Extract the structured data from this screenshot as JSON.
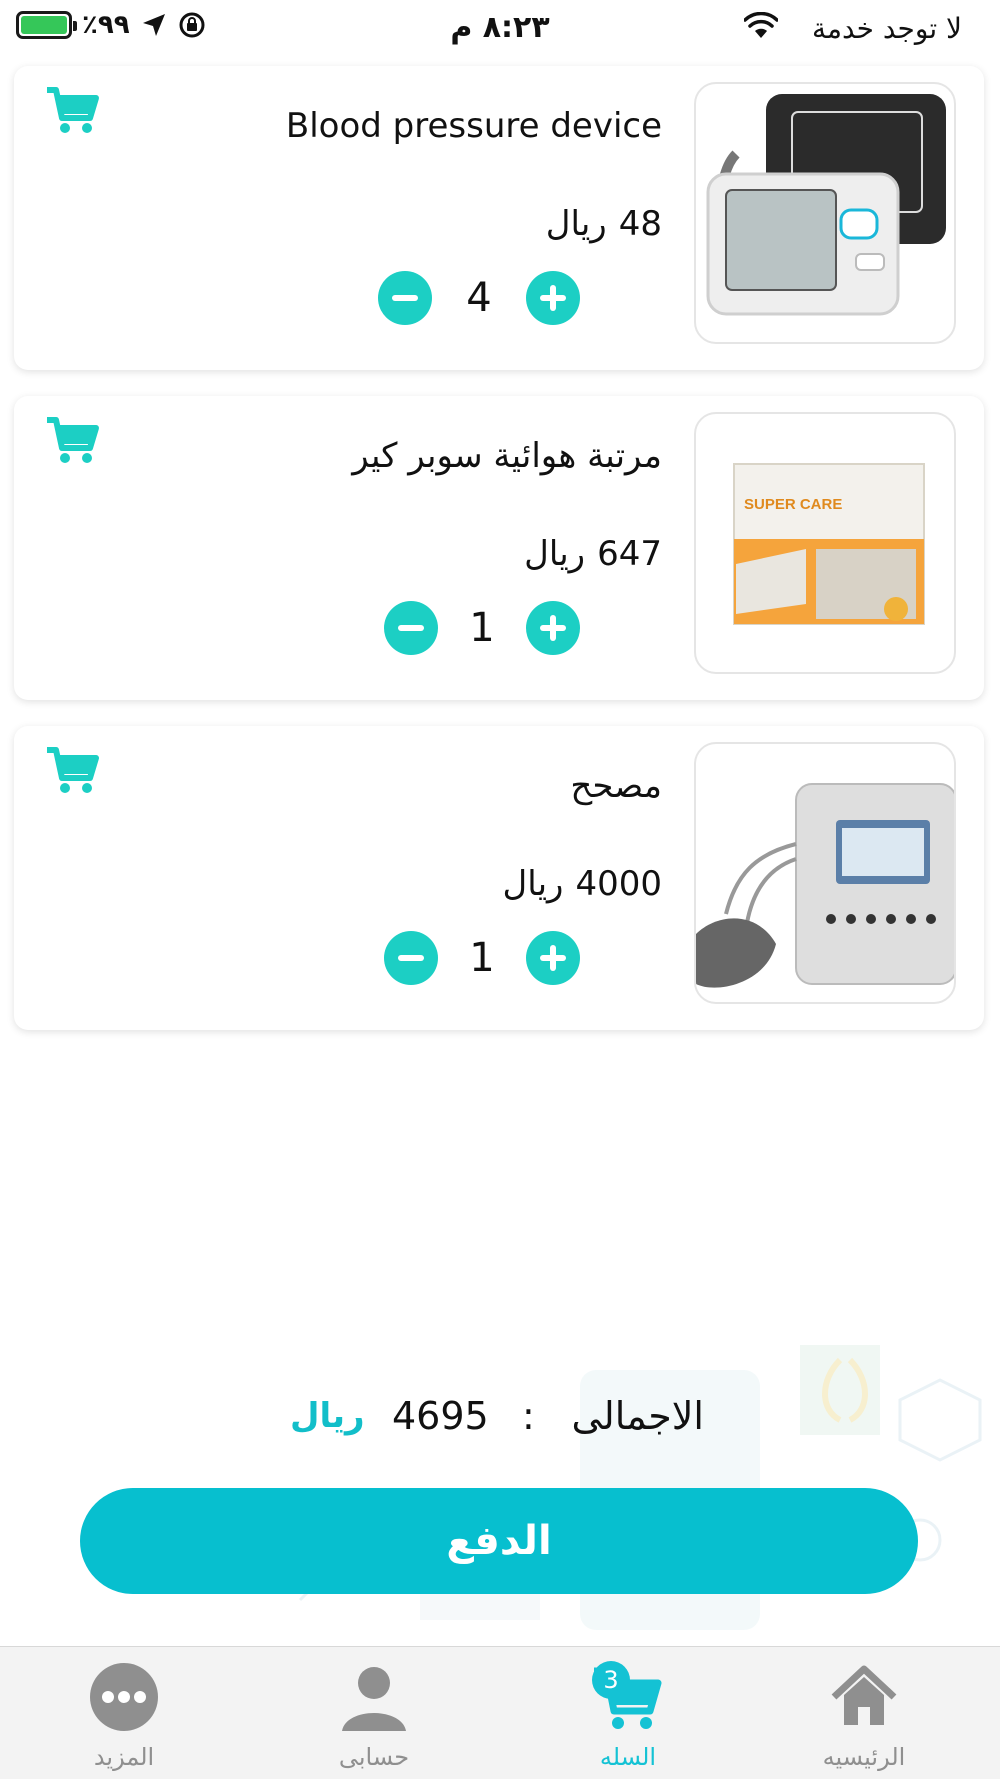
{
  "status_bar": {
    "carrier": "لا توجد خدمة",
    "time": "٨:٢٣ م",
    "battery_percent": "٪٩٩",
    "battery_level": 0.99
  },
  "cart_items": [
    {
      "name": "Blood pressure device",
      "price": "48",
      "currency": "ريال",
      "quantity": "4"
    },
    {
      "name": "مرتبة هوائية سوبر كير",
      "price": "647",
      "currency": "ريال",
      "quantity": "1"
    },
    {
      "name": "مصحح",
      "price": "4000",
      "currency": "ريال",
      "quantity": "1"
    }
  ],
  "total": {
    "label": "الاجمالى",
    "colon": ":",
    "value": "4695",
    "currency": "ريال"
  },
  "pay_button": {
    "label": "الدفع"
  },
  "tabs": [
    {
      "label": "الرئيسيه",
      "icon": "home-icon"
    },
    {
      "label": "السله",
      "icon": "cart-icon",
      "badge": "3",
      "active": true
    },
    {
      "label": "حسابى",
      "icon": "user-icon"
    },
    {
      "label": "المزيد",
      "icon": "more-icon"
    }
  ],
  "colors": {
    "accent": "#1ccfc4",
    "pay": "#07bfcf",
    "tab_active": "#14c2d4"
  }
}
